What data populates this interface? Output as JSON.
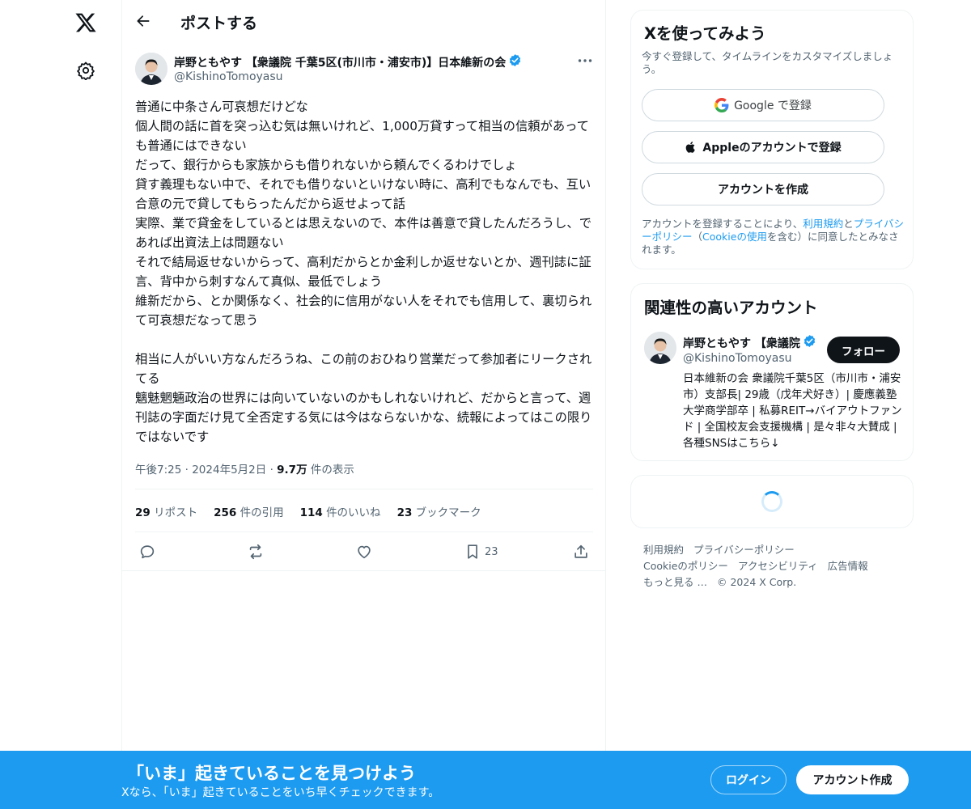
{
  "nav": {
    "logo": "x-logo-icon",
    "settings": "gear-icon"
  },
  "header": {
    "title": "ポストする"
  },
  "post": {
    "author_name": "岸野ともやす 【衆議院 千葉5区(市川市・浦安市)】日本維新の会",
    "author_handle": "@KishinoTomoyasu",
    "paragraphs": [
      "普通に中条さん可哀想だけどな",
      "個人間の話に首を突っ込む気は無いけれど、1,000万貸すって相当の信頼があっても普通にはできない",
      "だって、銀行からも家族からも借りれないから頼んでくるわけでしょ",
      "貸す義理もない中で、それでも借りないといけない時に、高利でもなんでも、互い合意の元で貸してもらったんだから返せよって話",
      "実際、業で貸金をしているとは思えないので、本件は善意で貸したんだろうし、であれば出資法上は問題ない",
      "それで結局返せないからって、高利だからとか金利しか返せないとか、週刊誌に証言、背中から刺すなんて真似、最低でしょう",
      "維新だから、とか関係なく、社会的に信用がない人をそれでも信用して、裏切られて可哀想だなって思う",
      "",
      "相当に人がいい方なんだろうね、この前のおひねり営業だって参加者にリークされてる",
      "魑魅魍魎政治の世界には向いていないのかもしれないけれど、だからと言って、週刊誌の字面だけ見て全否定する気には今はならないかな、続報によってはこの限りではないです"
    ],
    "time": "午後7:25",
    "date": "2024年5月2日",
    "views_count": "9.7万",
    "views_label": "件の表示",
    "stats": {
      "reposts_count": "29",
      "reposts_label": "リポスト",
      "quotes_count": "256",
      "quotes_label": "件の引用",
      "likes_count": "114",
      "likes_label": "件のいいね",
      "bookmarks_count": "23",
      "bookmarks_label": "ブックマーク"
    },
    "bookmark_action_count": "23"
  },
  "signup": {
    "title": "Xを使ってみよう",
    "subtitle": "今すぐ登録して、タイムラインをカスタマイズしましょう。",
    "google_label": "Google で登録",
    "apple_label": "Appleのアカウントで登録",
    "create_label": "アカウントを作成",
    "legal_prefix": "アカウントを登録することにより、",
    "legal_terms": "利用規約",
    "legal_and": "と",
    "legal_privacy": "プライバシーポリシー",
    "legal_open": "（",
    "legal_cookie": "Cookieの使用",
    "legal_suffix": "を含む）に同意したとみなされます。"
  },
  "related": {
    "title": "関連性の高いアカウント",
    "name": "岸野ともやす 【衆議院",
    "handle": "@KishinoTomoyasu",
    "follow_label": "フォロー",
    "bio": "日本維新の会 衆議院千葉5区（市川市・浦安市）支部長| 29歳（戊年犬好き）| 慶應義塾大学商学部卒 | 私募REIT→バイアウトファンド | 全国校友会支援機構 | 是々非々大賛成 | 各種SNSはこちら↓"
  },
  "footer": {
    "terms": "利用規約",
    "privacy": "プライバシーポリシー",
    "cookie": "Cookieのポリシー",
    "accessibility": "アクセシビリティ",
    "ads": "広告情報",
    "more": "もっと見る …",
    "copyright": "© 2024 X Corp."
  },
  "bottombar": {
    "title": "「いま」起きていることを見つけよう",
    "subtitle": "Xなら、「いま」起きていることをいち早くチェックできます。",
    "login_label": "ログイン",
    "signup_label": "アカウント作成"
  },
  "colors": {
    "accent": "#1d9bf0",
    "text": "#0f1419",
    "muted": "#536471",
    "border": "#eff3f4"
  }
}
